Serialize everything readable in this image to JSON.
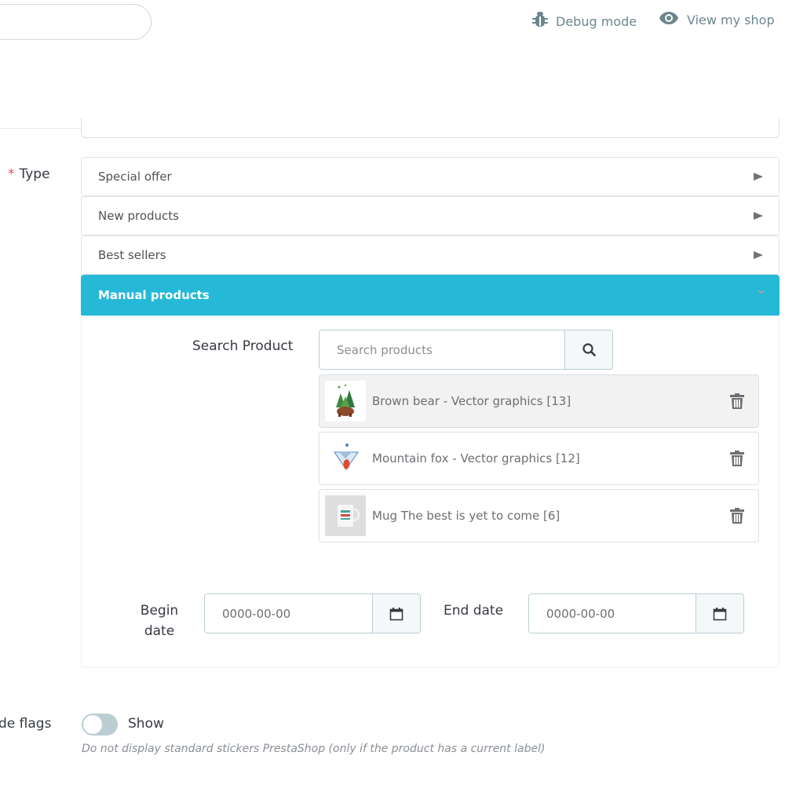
{
  "header": {
    "debug_label": "Debug mode",
    "debug_icon": "bug-icon",
    "view_shop_label": "View my shop",
    "view_shop_icon": "eye-icon"
  },
  "form": {
    "type": {
      "label": "Type",
      "required_marker": "*",
      "options": [
        {
          "label": "Special offer",
          "state": "collapsed"
        },
        {
          "label": "New products",
          "state": "collapsed"
        },
        {
          "label": "Best sellers",
          "state": "collapsed"
        },
        {
          "label": "Manual products",
          "state": "expanded"
        }
      ],
      "accent_color": "#25b9d7"
    },
    "search": {
      "label": "Search Product",
      "placeholder": "Search products",
      "value": ""
    },
    "products": [
      {
        "name": "Brown bear - Vector graphics [13]",
        "thumb": "brown-bear-thumbnail"
      },
      {
        "name": "Mountain fox - Vector graphics [12]",
        "thumb": "mountain-fox-thumbnail"
      },
      {
        "name": "Mug The best is yet to come [6]",
        "thumb": "mug-thumbnail"
      }
    ],
    "begin_date": {
      "label": "Begin date",
      "value": "0000-00-00"
    },
    "end_date": {
      "label": "End date",
      "value": "0000-00-00"
    },
    "hide_flags": {
      "label": "de flags",
      "toggle_state": "off",
      "toggle_text": "Show",
      "help": "Do not display standard stickers PrestaShop (only if the product has a current label)"
    }
  }
}
